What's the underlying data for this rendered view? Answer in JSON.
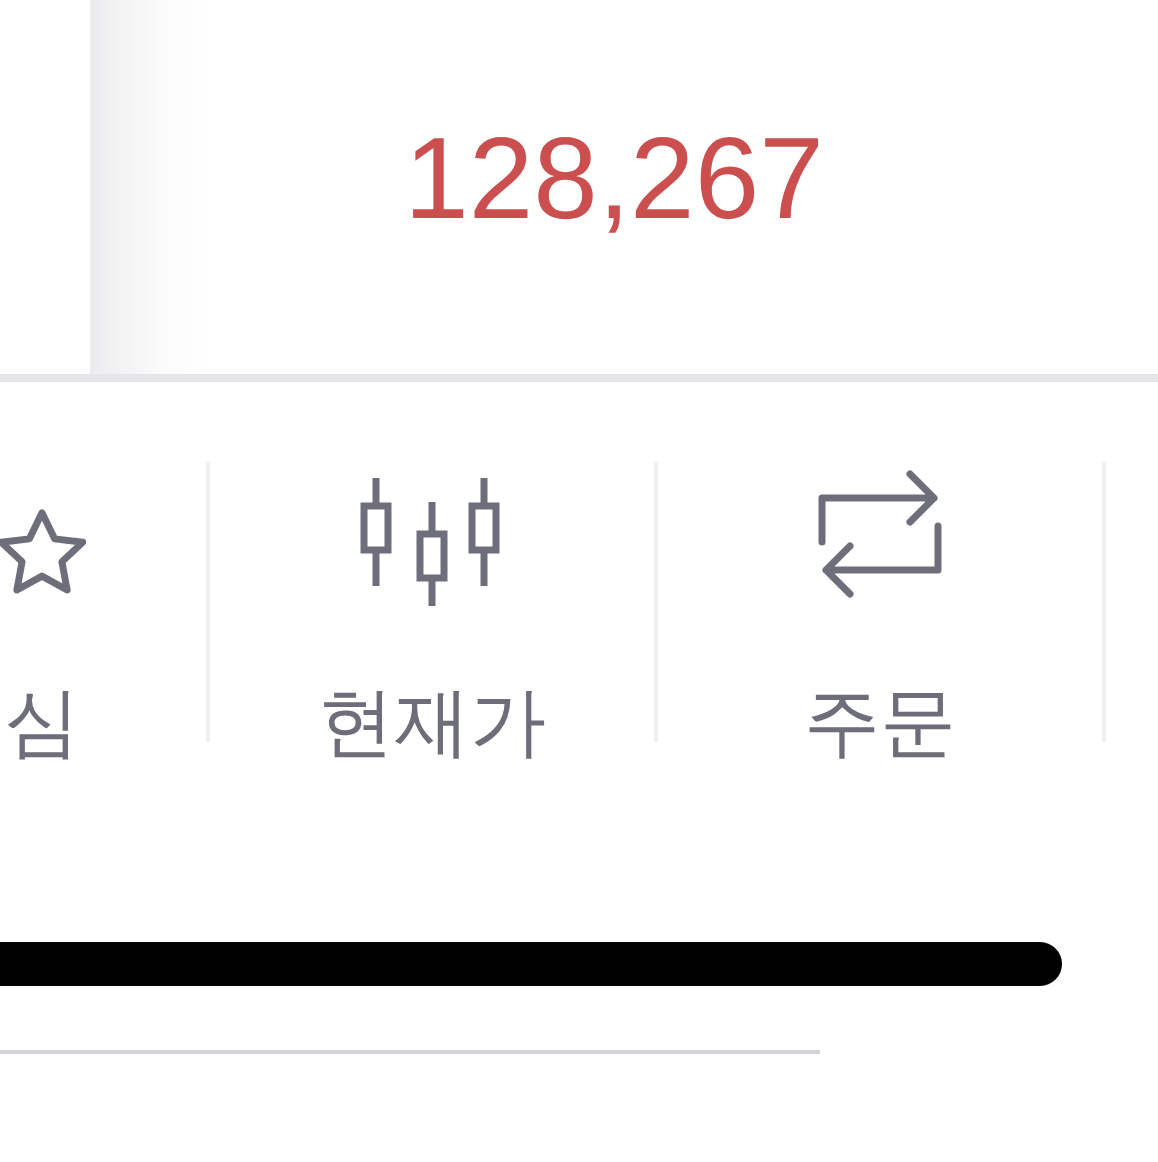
{
  "price": {
    "value": "128,267"
  },
  "tabs": [
    {
      "kind": "star",
      "label": "심"
    },
    {
      "kind": "chart",
      "label": "현재가"
    },
    {
      "kind": "exchange",
      "label": "주문"
    }
  ]
}
